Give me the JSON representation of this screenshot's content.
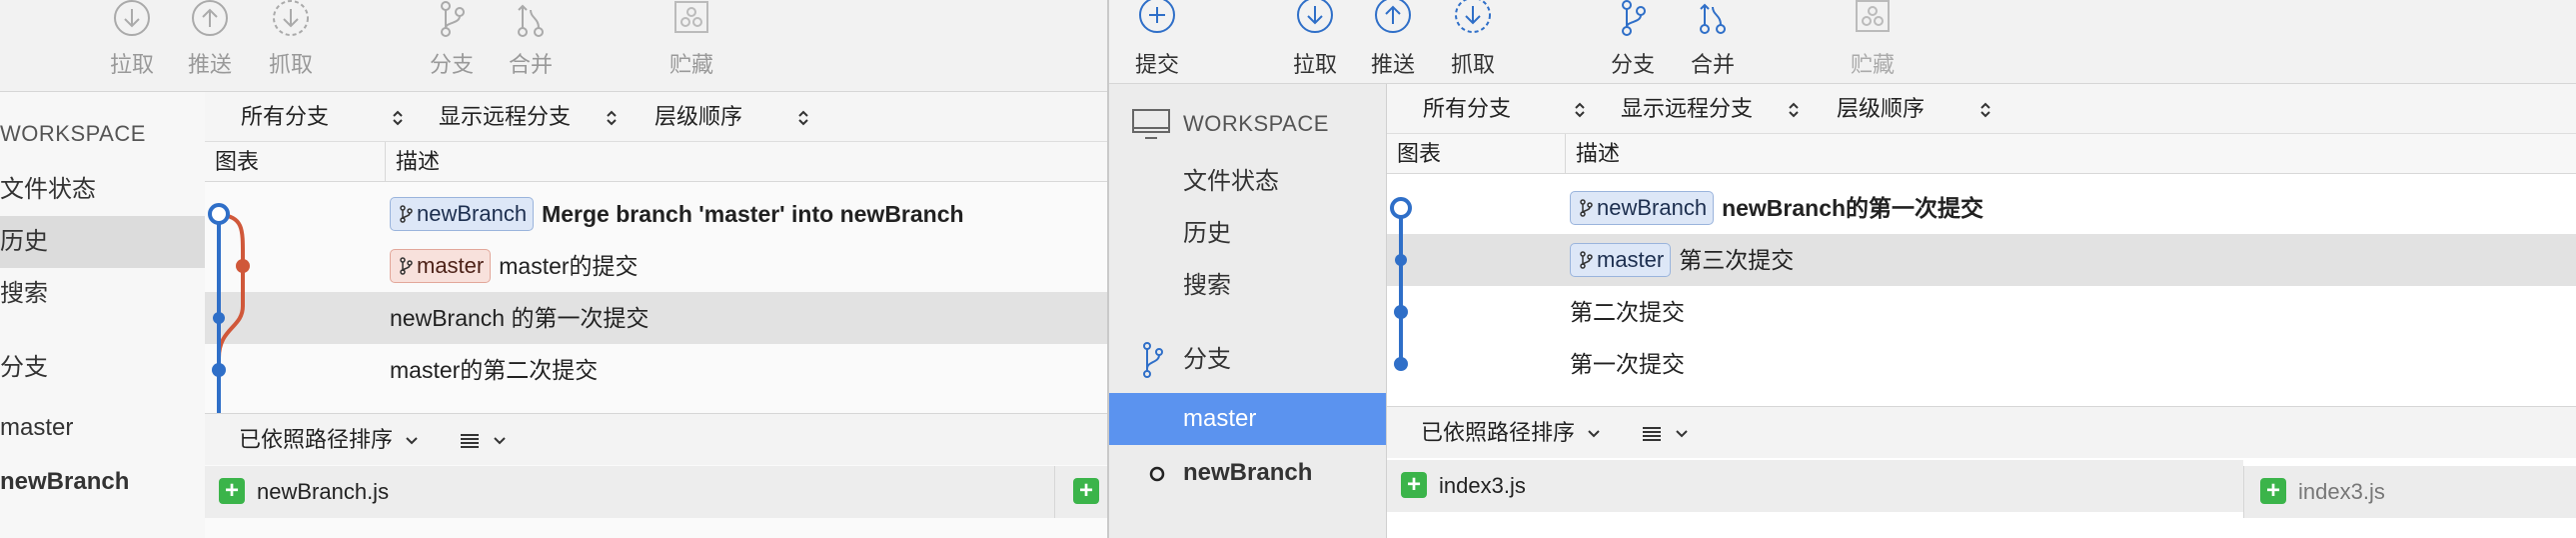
{
  "left": {
    "toolbar": [
      {
        "label": "拉取",
        "icon": "pull-icon"
      },
      {
        "label": "推送",
        "icon": "push-icon"
      },
      {
        "label": "抓取",
        "icon": "fetch-icon"
      },
      {
        "label": "分支",
        "icon": "branch-icon"
      },
      {
        "label": "合并",
        "icon": "merge-icon"
      },
      {
        "label": "贮藏",
        "icon": "stash-icon"
      }
    ],
    "sidebar": {
      "workspace": "WORKSPACE",
      "file_status": "文件状态",
      "history": "历史",
      "search": "搜索",
      "branches": "分支",
      "branch_master": "master",
      "branch_newbranch": "newBranch"
    },
    "filters": {
      "all_branches": "所有分支",
      "show_remote": "显示远程分支",
      "order": "层级顺序"
    },
    "columns": {
      "graph": "图表",
      "description": "描述"
    },
    "commits": [
      {
        "badge": "newBranch",
        "message": "Merge branch 'master' into newBranch"
      },
      {
        "badge": "master",
        "message": "master的提交"
      },
      {
        "badge": "",
        "message": "newBranch 的第一次提交"
      },
      {
        "badge": "",
        "message": "master的第二次提交"
      }
    ],
    "sort_label": "已依照路径排序",
    "files": [
      {
        "name": "newBranch.js"
      }
    ]
  },
  "right": {
    "toolbar": [
      {
        "label": "提交",
        "icon": "commit-icon"
      },
      {
        "label": "拉取",
        "icon": "pull-icon"
      },
      {
        "label": "推送",
        "icon": "push-icon"
      },
      {
        "label": "抓取",
        "icon": "fetch-icon"
      },
      {
        "label": "分支",
        "icon": "branch-icon"
      },
      {
        "label": "合并",
        "icon": "merge-icon"
      },
      {
        "label": "贮藏",
        "icon": "stash-icon"
      }
    ],
    "sidebar": {
      "workspace": "WORKSPACE",
      "file_status": "文件状态",
      "history": "历史",
      "search": "搜索",
      "branches": "分支",
      "branch_master": "master",
      "branch_newbranch": "newBranch"
    },
    "filters": {
      "all_branches": "所有分支",
      "show_remote": "显示远程分支",
      "order": "层级顺序"
    },
    "columns": {
      "graph": "图表",
      "description": "描述"
    },
    "commits": [
      {
        "badge": "newBranch",
        "message": "newBranch的第一次提交"
      },
      {
        "badge": "master",
        "message": "第三次提交"
      },
      {
        "badge": "",
        "message": "第二次提交"
      },
      {
        "badge": "",
        "message": "第一次提交"
      }
    ],
    "sort_label": "已依照路径排序",
    "files": [
      {
        "name": "index3.js"
      },
      {
        "name": "index3.js"
      }
    ]
  },
  "colors": {
    "graph_blue": "#2f6fc8",
    "graph_red": "#d0583a",
    "selected_blue": "#5b93ef",
    "added_green": "#3bb44a"
  }
}
